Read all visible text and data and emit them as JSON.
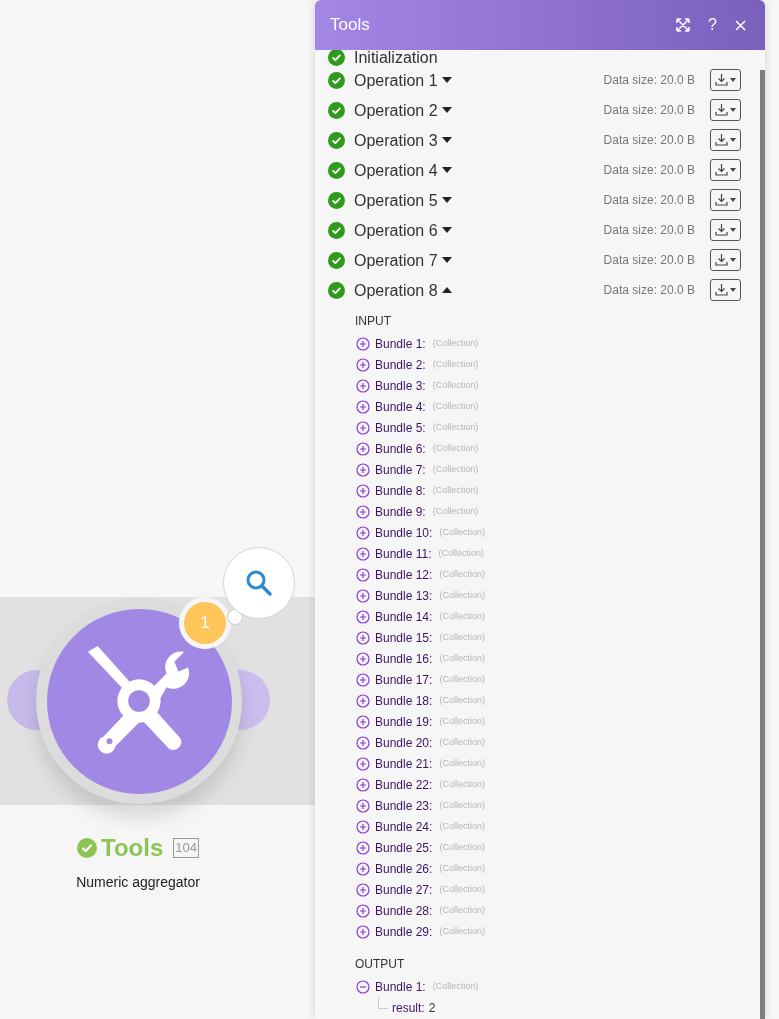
{
  "module": {
    "name": "Tools",
    "badge": "104",
    "subtitle": "Numeric aggregator",
    "count": "1"
  },
  "panel": {
    "title": "Tools",
    "help": "?",
    "operations": [
      {
        "label": "Initialization"
      },
      {
        "label": "Operation 1",
        "expanded": false,
        "size": "Data size: 20.0 B"
      },
      {
        "label": "Operation 2",
        "expanded": false,
        "size": "Data size: 20.0 B"
      },
      {
        "label": "Operation 3",
        "expanded": false,
        "size": "Data size: 20.0 B"
      },
      {
        "label": "Operation 4",
        "expanded": false,
        "size": "Data size: 20.0 B"
      },
      {
        "label": "Operation 5",
        "expanded": false,
        "size": "Data size: 20.0 B"
      },
      {
        "label": "Operation 6",
        "expanded": false,
        "size": "Data size: 20.0 B"
      },
      {
        "label": "Operation 7",
        "expanded": false,
        "size": "Data size: 20.0 B"
      },
      {
        "label": "Operation 8",
        "expanded": true,
        "size": "Data size: 20.0 B",
        "sections": [
          {
            "title": "INPUT",
            "bundles": [
              {
                "label": "Bundle 1:",
                "type": "(Collection)",
                "expanded": false
              },
              {
                "label": "Bundle 2:",
                "type": "(Collection)",
                "expanded": false
              },
              {
                "label": "Bundle 3:",
                "type": "(Collection)",
                "expanded": false
              },
              {
                "label": "Bundle 4:",
                "type": "(Collection)",
                "expanded": false
              },
              {
                "label": "Bundle 5:",
                "type": "(Collection)",
                "expanded": false
              },
              {
                "label": "Bundle 6:",
                "type": "(Collection)",
                "expanded": false
              },
              {
                "label": "Bundle 7:",
                "type": "(Collection)",
                "expanded": false
              },
              {
                "label": "Bundle 8:",
                "type": "(Collection)",
                "expanded": false
              },
              {
                "label": "Bundle 9:",
                "type": "(Collection)",
                "expanded": false
              },
              {
                "label": "Bundle 10:",
                "type": "(Collection)",
                "expanded": false
              },
              {
                "label": "Bundle 11:",
                "type": "(Collection)",
                "expanded": false
              },
              {
                "label": "Bundle 12:",
                "type": "(Collection)",
                "expanded": false
              },
              {
                "label": "Bundle 13:",
                "type": "(Collection)",
                "expanded": false
              },
              {
                "label": "Bundle 14:",
                "type": "(Collection)",
                "expanded": false
              },
              {
                "label": "Bundle 15:",
                "type": "(Collection)",
                "expanded": false
              },
              {
                "label": "Bundle 16:",
                "type": "(Collection)",
                "expanded": false
              },
              {
                "label": "Bundle 17:",
                "type": "(Collection)",
                "expanded": false
              },
              {
                "label": "Bundle 18:",
                "type": "(Collection)",
                "expanded": false
              },
              {
                "label": "Bundle 19:",
                "type": "(Collection)",
                "expanded": false
              },
              {
                "label": "Bundle 20:",
                "type": "(Collection)",
                "expanded": false
              },
              {
                "label": "Bundle 21:",
                "type": "(Collection)",
                "expanded": false
              },
              {
                "label": "Bundle 22:",
                "type": "(Collection)",
                "expanded": false
              },
              {
                "label": "Bundle 23:",
                "type": "(Collection)",
                "expanded": false
              },
              {
                "label": "Bundle 24:",
                "type": "(Collection)",
                "expanded": false
              },
              {
                "label": "Bundle 25:",
                "type": "(Collection)",
                "expanded": false
              },
              {
                "label": "Bundle 26:",
                "type": "(Collection)",
                "expanded": false
              },
              {
                "label": "Bundle 27:",
                "type": "(Collection)",
                "expanded": false
              },
              {
                "label": "Bundle 28:",
                "type": "(Collection)",
                "expanded": false
              },
              {
                "label": "Bundle 29:",
                "type": "(Collection)",
                "expanded": false
              }
            ]
          },
          {
            "title": "OUTPUT",
            "bundles": [
              {
                "label": "Bundle 1:",
                "type": "(Collection)",
                "expanded": true,
                "children": [
                  {
                    "key": "result:",
                    "value": "2"
                  }
                ]
              }
            ]
          }
        ]
      }
    ]
  }
}
